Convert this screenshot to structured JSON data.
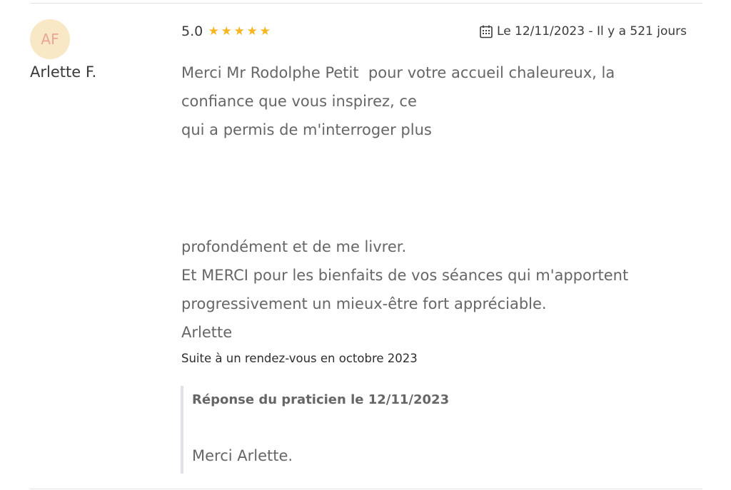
{
  "review": {
    "avatar_initials": "AF",
    "author": "Arlette F.",
    "rating_value": "5.0",
    "rating_stars": 5,
    "star_color": "#f6b622",
    "date_text": "Le 12/11/2023 - Il y a 521 jours",
    "text_lines_top": [
      "Merci Mr Rodolphe Petit  pour votre accueil chaleureux, la",
      "confiance que vous inspirez, ce",
      "qui a permis de m'interroger plus"
    ],
    "text_lines_bottom": [
      "profondément et de me livrer.",
      "Et MERCI pour les bienfaits de vos séances qui m'apportent",
      "progressivement un mieux-être fort appréciable.",
      "Arlette"
    ],
    "visit_context": "Suite à un rendez-vous en octobre 2023"
  },
  "reply": {
    "title": "Réponse du praticien le 12/11/2023",
    "text": "Merci Arlette."
  },
  "icons": {
    "calendar": "calendar-icon",
    "star": "star-icon"
  }
}
